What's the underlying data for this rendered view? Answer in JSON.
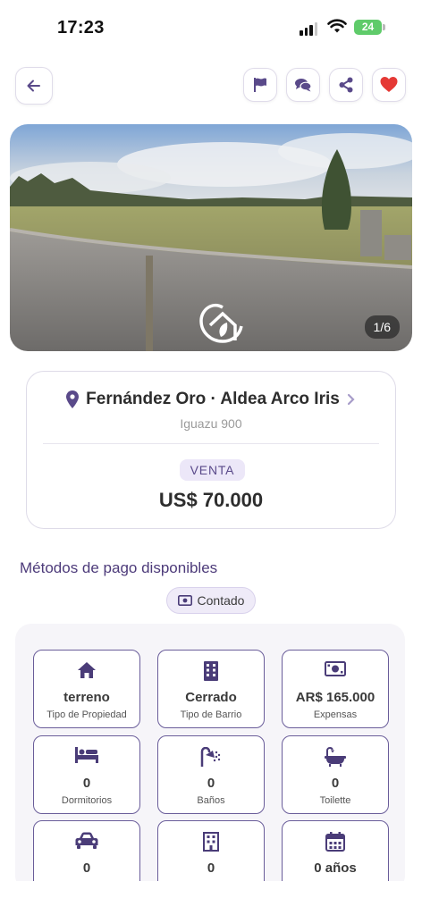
{
  "status_bar": {
    "time": "17:23",
    "battery": "24"
  },
  "header": {
    "back_icon": "arrow-left-icon",
    "actions": [
      "flag-icon",
      "chat-icon",
      "share-icon",
      "heart-icon"
    ]
  },
  "gallery": {
    "counter": "1/6",
    "watermark_icon": "agency-logo"
  },
  "listing": {
    "location": "Fernández Oro · Aldea Arco Iris",
    "address": "Iguazu 900",
    "operation": "VENTA",
    "price": "US$ 70.000"
  },
  "payment": {
    "title": "Métodos de pago disponibles",
    "method": "Contado"
  },
  "features": [
    {
      "icon": "house-icon",
      "value": "terreno",
      "label": "Tipo de Propiedad"
    },
    {
      "icon": "building-icon",
      "value": "Cerrado",
      "label": "Tipo de Barrio"
    },
    {
      "icon": "money-icon",
      "value": "AR$ 165.000",
      "label": "Expensas"
    },
    {
      "icon": "bed-icon",
      "value": "0",
      "label": "Dormitorios"
    },
    {
      "icon": "shower-icon",
      "value": "0",
      "label": "Baños"
    },
    {
      "icon": "bathtub-icon",
      "value": "0",
      "label": "Toilette"
    },
    {
      "icon": "car-icon",
      "value": "0",
      "label": ""
    },
    {
      "icon": "floors-icon",
      "value": "0",
      "label": ""
    },
    {
      "icon": "calendar-icon",
      "value": "0 años",
      "label": ""
    }
  ],
  "colors": {
    "brand": "#5a4a8a",
    "heart": "#e53935",
    "border": "#6a5d9a"
  }
}
